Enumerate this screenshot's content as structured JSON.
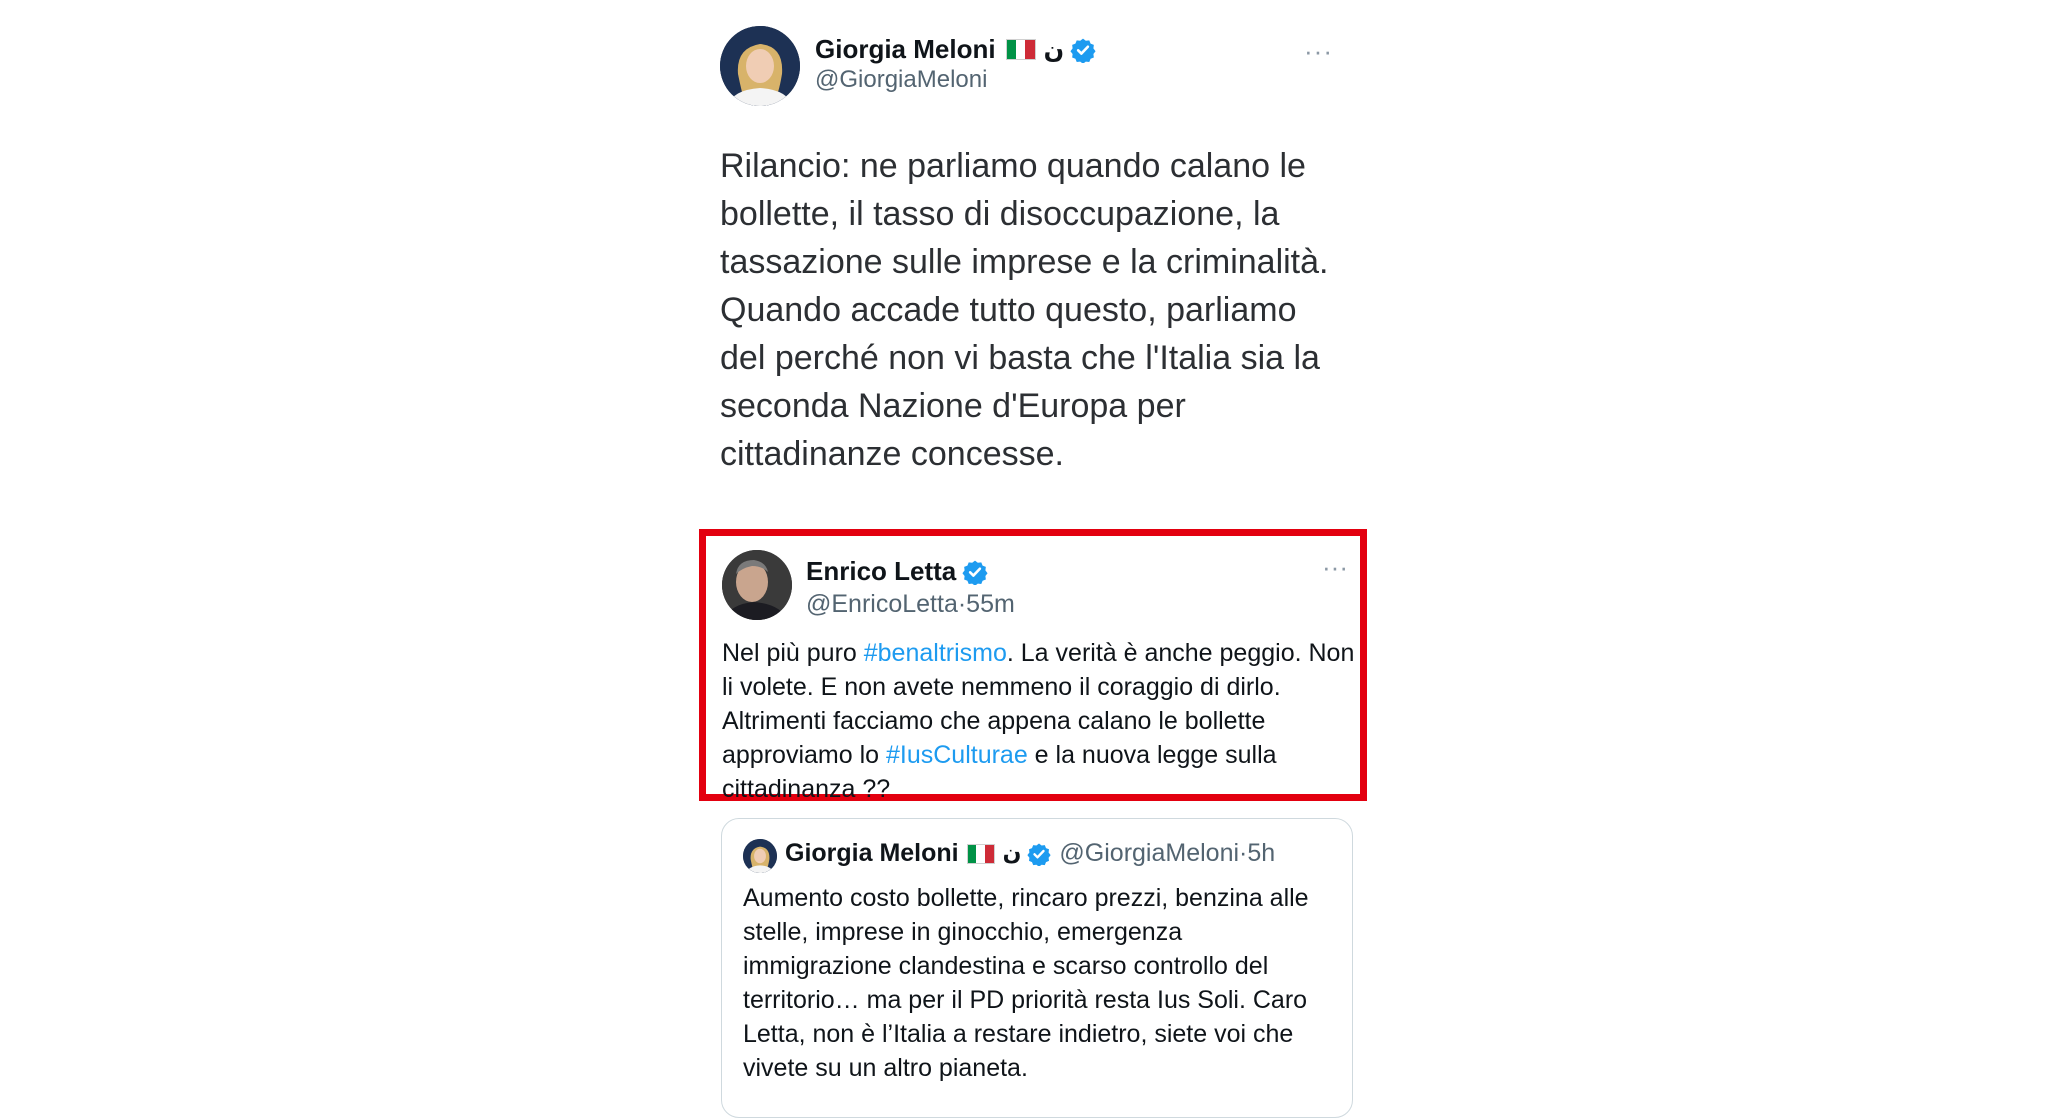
{
  "main_tweet": {
    "author_name": "Giorgia Meloni",
    "arabic_char": "ن",
    "handle": "@GiorgiaMeloni",
    "more": "···",
    "text": "Rilancio: ne parliamo quando calano le bollette, il tasso di disoccupazione, la tassazione sulle imprese e la criminalità. Quando accade tutto questo, parliamo del perché non vi basta che l'Italia sia la seconda Nazione d'Europa per cittadinanze concesse."
  },
  "reply_tweet": {
    "author_name": "Enrico Letta",
    "handle": "@EnricoLetta",
    "separator": "·",
    "time": "55m",
    "more": "···",
    "text_part1": "Nel più puro ",
    "hashtag1": "#benaltrismo",
    "text_part2": ". La verità è anche peggio. Non li volete. E non avete nemmeno il coraggio di dirlo. Altrimenti facciamo che appena calano le bollette approviamo lo ",
    "hashtag2": "#IusCulturae",
    "text_part3": " e la nuova legge sulla cittadinanza ??"
  },
  "quoted_tweet": {
    "author_name": "Giorgia Meloni",
    "arabic_char": "ن",
    "handle": "@GiorgiaMeloni",
    "separator": "·",
    "time": "5h",
    "text": "Aumento costo bollette, rincaro prezzi, benzina alle stelle, imprese in ginocchio, emergenza immigrazione clandestina e scarso controllo del territorio… ma per il PD priorità resta Ius Soli. Caro Letta, non è l’Italia a restare indietro, siete voi che vivete su un altro pianeta."
  },
  "colors": {
    "highlight_border": "#e3000f",
    "hashtag": "#1d9bf0",
    "verified": "#1d9bf0",
    "secondary_text": "#536471"
  },
  "icons": [
    "italy-flag-icon",
    "verified-badge-icon",
    "more-options-icon"
  ]
}
